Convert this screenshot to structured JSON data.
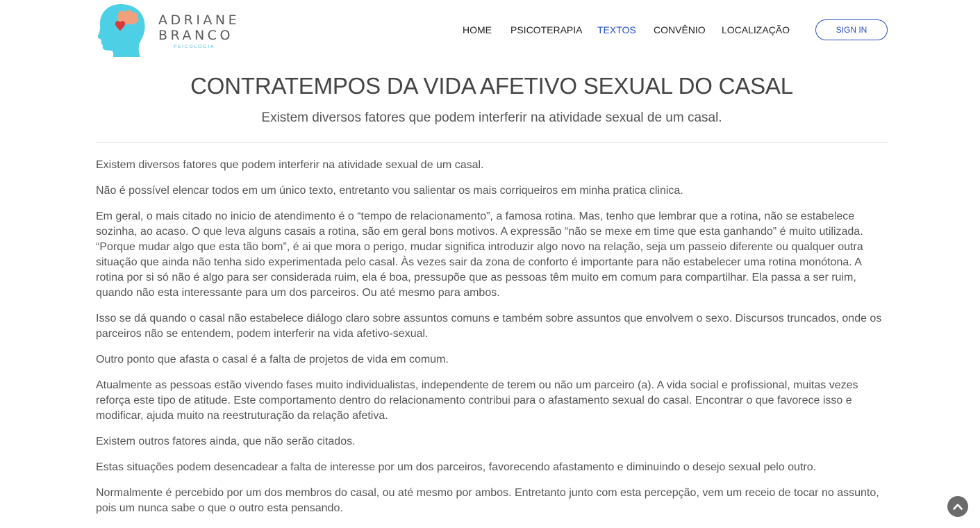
{
  "logo": {
    "line1": "ADRIANE",
    "line2": "BRANCO",
    "line3": "PSICOLOGIA"
  },
  "nav": {
    "items": [
      {
        "label": "HOME"
      },
      {
        "label": "PSICOTERAPIA"
      },
      {
        "label": "TEXTOS",
        "active": true
      },
      {
        "label": "CONVÊNIO"
      },
      {
        "label": "LOCALIZAÇÃO"
      }
    ],
    "signin_label": "SIGN IN"
  },
  "colors": {
    "accent": "#2a4fbf",
    "logo_head": "#4dd0e6",
    "logo_heart": "#d9383b",
    "logo_brain": "#f2a07b",
    "text": "#555555"
  },
  "article": {
    "title": "CONTRATEMPOS DA VIDA AFETIVO SEXUAL DO CASAL",
    "subtitle": "Existem diversos fatores que podem interferir na atividade sexual de um casal.",
    "paragraphs": [
      "Existem diversos fatores que podem interferir na atividade sexual de um casal.",
      "Não é possível elencar todos em um único texto, entretanto vou salientar os mais corriqueiros em minha pratica clinica.",
      "Em geral, o mais citado no inicio de atendimento é o “tempo de relacionamento”, a famosa rotina. Mas, tenho que lembrar que a rotina, não se estabelece sozinha, ao acaso. O que leva alguns casais a rotina, são em geral bons motivos. A expressão “não se mexe em time que esta ganhando” é muito utilizada. “Porque mudar algo que esta tão bom”, é ai que mora o perigo, mudar significa introduzir algo novo na relação, seja um passeio diferente ou qualquer outra situação que ainda não tenha sido experimentada pelo casal. Às vezes sair da zona de conforto é importante para não estabelecer uma rotina monótona. A rotina por si só não é algo para ser considerada ruim, ela é boa, pressupõe que as pessoas têm muito em comum para compartilhar. Ela passa a ser ruim, quando não esta interessante para um dos parceiros. Ou até mesmo para ambos.",
      "Isso se dá quando o casal não estabelece diálogo claro sobre assuntos comuns e também sobre assuntos que envolvem o sexo. Discursos truncados, onde os parceiros não se entendem, podem interferir na vida afetivo-sexual.",
      "Outro ponto que afasta o casal é a falta de projetos de vida em comum.",
      "Atualmente as pessoas estão vivendo fases muito individualistas, independente de terem ou não um parceiro (a). A vida social e profissional, muitas vezes reforça este tipo de atitude. Este comportamento dentro do relacionamento contribui para o afastamento sexual do casal. Encontrar o que favorece isso e modificar, ajuda muito na reestruturação da relação afetiva.",
      "Existem outros fatores ainda, que não serão citados.",
      "Estas situações podem desencadear a falta de interesse por um dos parceiros, favorecendo afastamento e diminuindo o desejo sexual pelo outro.",
      "Normalmente é percebido por um dos membros do casal, ou até mesmo por ambos. Entretanto junto com esta percepção, vem um receio de tocar no assunto, pois um nunca sabe o que o outro esta pensando."
    ]
  },
  "scroll_top_icon": "chevron-up-icon"
}
